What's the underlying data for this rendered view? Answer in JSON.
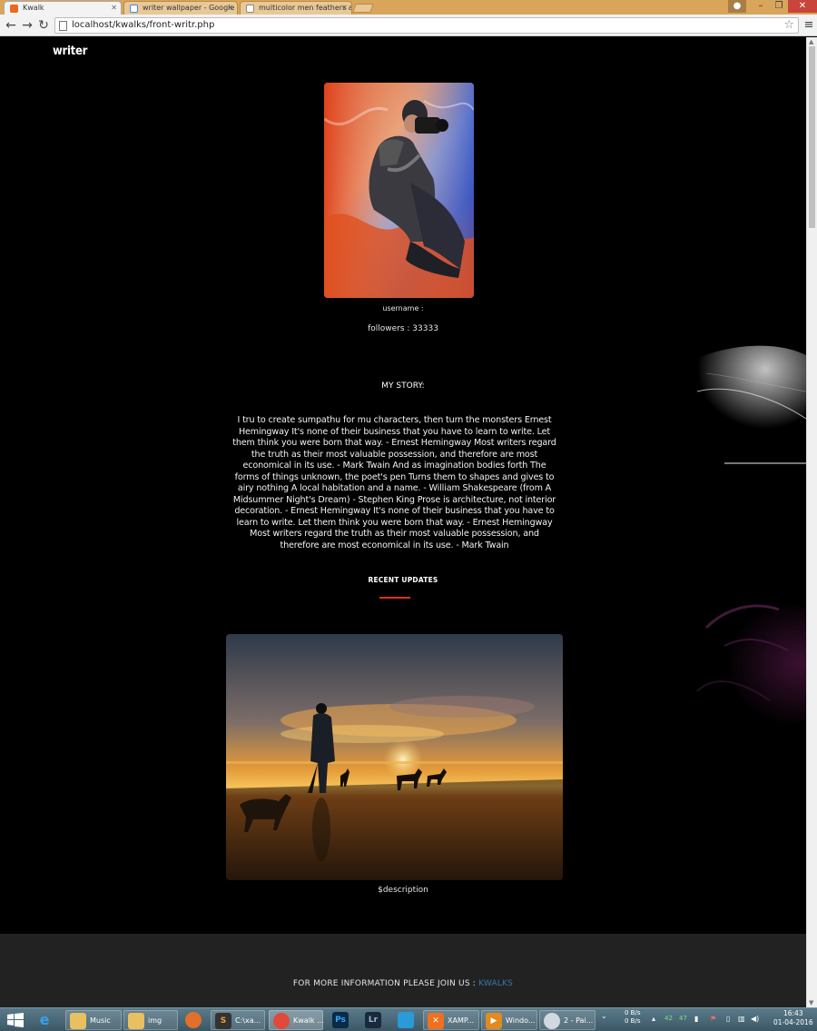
{
  "browser": {
    "tabs": [
      {
        "title": "Kwalk",
        "active": true
      },
      {
        "title": "writer wallpaper - Google"
      },
      {
        "title": "multicolor men feathers a"
      }
    ],
    "url": "localhost/kwalks/front-writr.php"
  },
  "page": {
    "brand": "writer",
    "username_label": "username :",
    "followers_label": "followers : 33333",
    "story_heading": "MY STORY:",
    "story_text": "I tru to create sumpathu for mu characters, then turn the monsters Ernest Hemingway It's none of their business that you have to learn to write. Let them think you were born that way. - Ernest Hemingway Most writers regard the truth as their most valuable possession, and therefore are most economical in its use. - Mark Twain And as imagination bodies forth The forms of things unknown, the poet's pen Turns them to shapes and gives to airy nothing A local habitation and a name. - William Shakespeare (from A Midsummer Night's Dream) - Stephen King Prose is architecture, not interior decoration. - Ernest Hemingway It's none of their business that you have to learn to write. Let them think you were born that way. - Ernest Hemingway Most writers regard the truth as their most valuable possession, and therefore are most economical in its use. - Mark Twain",
    "recent_heading": "RECENT UPDATES",
    "update_description": "$description",
    "footer_text": "FOR MORE INFORMATION PLEASE JOIN US :",
    "footer_link": "KWALKS"
  },
  "taskbar": {
    "items": [
      {
        "label": "Music"
      },
      {
        "label": "img"
      },
      {
        "label": "C:\\xa..."
      },
      {
        "label": "Kwalk ..."
      },
      {
        "label": "XAMP..."
      },
      {
        "label": "Windo..."
      },
      {
        "label": "2 - Pai..."
      }
    ],
    "net_down": "0 B/s",
    "net_up": "0 B/s",
    "tray_nums": [
      "42",
      "47"
    ],
    "time": "16:43",
    "date": "01-04-2016"
  },
  "colors": {
    "accent_underline": "#e0301e",
    "footer_link": "#3a78a8",
    "footer_bg": "#222222"
  }
}
